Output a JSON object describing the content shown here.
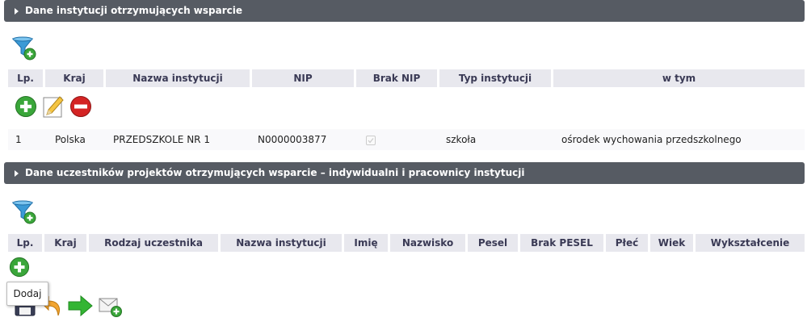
{
  "section1": {
    "title": "Dane instytucji otrzymujących wsparcie",
    "columns": [
      "Lp.",
      "Kraj",
      "Nazwa instytucji",
      "NIP",
      "Brak NIP",
      "Typ instytucji",
      "w tym"
    ],
    "rows": [
      {
        "lp": "1",
        "kraj": "Polska",
        "nazwa": "PRZEDSZKOLE NR 1",
        "nip": "N0000003877",
        "brak_nip": true,
        "typ": "szkoła",
        "w_tym": "ośrodek wychowania przedszkolnego"
      }
    ]
  },
  "section2": {
    "title": "Dane uczestników projektów otrzymujących wsparcie – indywidualni i pracownicy instytucji",
    "columns": [
      "Lp.",
      "Kraj",
      "Rodzaj uczestnika",
      "Nazwa instytucji",
      "Imię",
      "Nazwisko",
      "Pesel",
      "Brak PESEL",
      "Płeć",
      "Wiek",
      "Wykształcenie"
    ]
  },
  "tooltip": {
    "text": "Dodaj"
  },
  "icons": {
    "filter": "filter-add-icon",
    "add": "plus-circle-icon",
    "edit": "pencil-icon",
    "delete": "minus-circle-icon",
    "save": "save-icon",
    "undo": "undo-arrow-icon",
    "next": "right-arrow-icon",
    "send": "mail-add-icon"
  },
  "colors": {
    "header": "#565b63",
    "th_bg": "#e8e8ee",
    "add_green": "#3aa63a",
    "delete_red": "#d42424",
    "arrow_green": "#33b533",
    "undo_orange": "#f2a530"
  }
}
